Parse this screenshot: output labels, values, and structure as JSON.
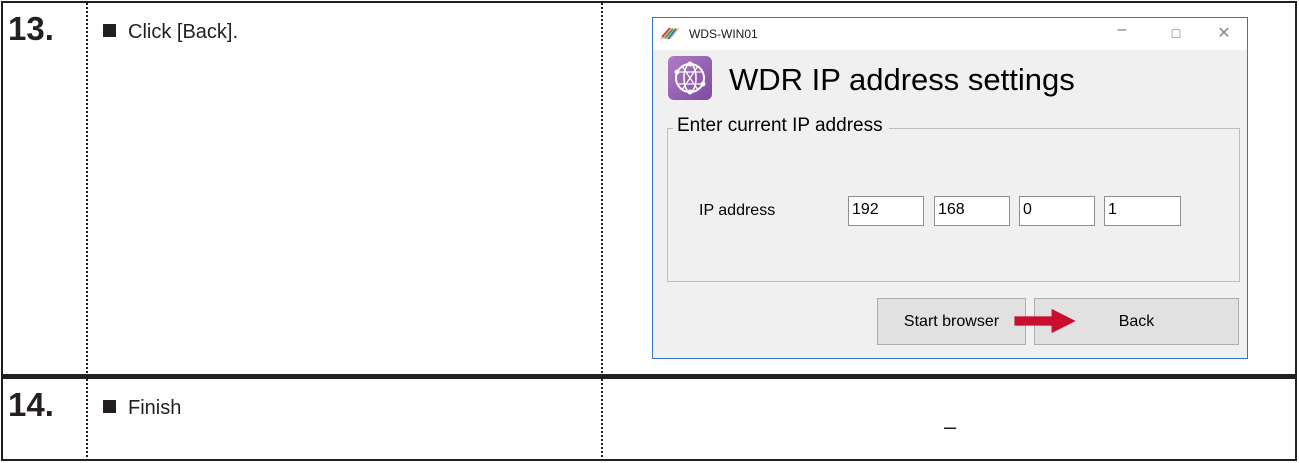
{
  "steps": [
    {
      "number": "13.",
      "instruction": "Click [Back]."
    },
    {
      "number": "14.",
      "instruction": "Finish",
      "result": "–"
    }
  ],
  "dialog": {
    "window_title": "WDS-WIN01",
    "controls": {
      "minimize": "–",
      "maximize": "□",
      "close": "✕"
    },
    "heading": "WDR IP address settings",
    "group_label": "Enter current IP address",
    "ip_label": "IP address",
    "ip_octets": [
      "192",
      "168",
      "0",
      "1"
    ],
    "buttons": {
      "start_browser": "Start browser",
      "back": "Back"
    },
    "icons": {
      "app": "app-logo-icon",
      "brand": "network-globe-icon",
      "pointer": "red-arrow-icon"
    },
    "colors": {
      "window_border": "#3b73c4",
      "arrow": "#c8102e",
      "logo": "#9b6bb8"
    }
  }
}
